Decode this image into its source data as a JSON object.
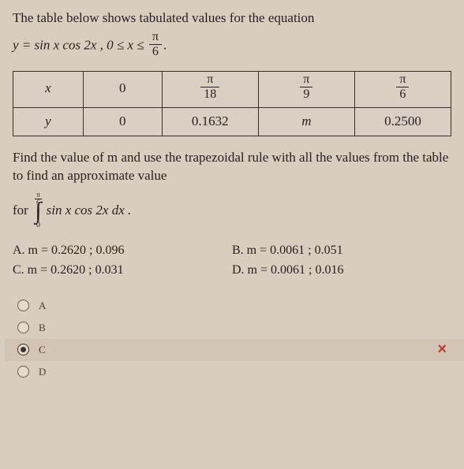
{
  "intro": "The table below shows tabulated values for the equation",
  "eq": {
    "lhs": "y = sin x cos 2x  ,  0 ≤ x ≤",
    "frac_num": "π",
    "frac_den": "6",
    "trail": "."
  },
  "table": {
    "row_x_label": "x",
    "row_y_label": "y",
    "cols": [
      {
        "x_text": "0",
        "y_text": "0"
      },
      {
        "x_num": "π",
        "x_den": "18",
        "y_text": "0.1632"
      },
      {
        "x_num": "π",
        "x_den": "9",
        "y_text": "m"
      },
      {
        "x_num": "π",
        "x_den": "6",
        "y_text": "0.2500"
      }
    ]
  },
  "prompt": "Find the value of m and use the trapezoidal rule with all the values from the table to find an approximate value",
  "integral": {
    "lead": "for",
    "upper_num": "π",
    "upper_den": "6",
    "lower": "0",
    "body": "sin x cos 2x dx ."
  },
  "answers": {
    "A": "A.  m = 0.2620 ; 0.096",
    "B": "B.  m = 0.0061 ; 0.051",
    "C": "C.  m = 0.2620 ; 0.031",
    "D": "D.  m = 0.0061 ; 0.016"
  },
  "options": {
    "A": "A",
    "B": "B",
    "C": "C",
    "D": "D"
  },
  "selected": "C",
  "mark": "×",
  "chart_data": {
    "type": "table",
    "title": "y = sin x cos 2x on [0, π/6]",
    "columns": [
      "x",
      "y"
    ],
    "rows": [
      {
        "x": "0",
        "y": 0
      },
      {
        "x": "π/18",
        "y": 0.1632
      },
      {
        "x": "π/9",
        "y": "m"
      },
      {
        "x": "π/6",
        "y": 0.25
      }
    ]
  }
}
